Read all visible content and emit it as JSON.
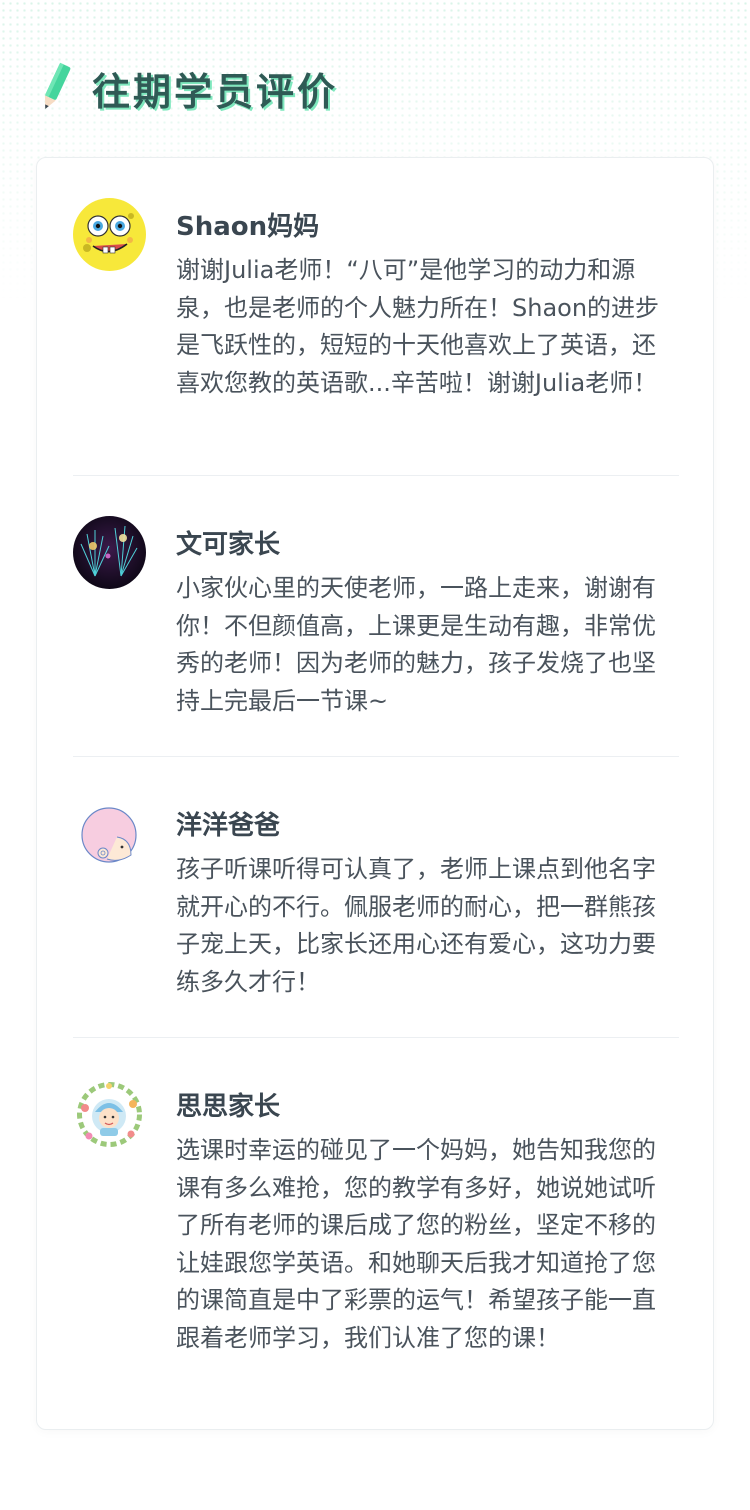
{
  "section": {
    "title": "往期学员评价"
  },
  "reviews": [
    {
      "name": "Shaon妈妈",
      "avatar": "spongebob-avatar",
      "comment": "谢谢Julia老师！“八可”是他学习的动力和源泉，也是老师的个人魅力所在！Shaon的进步是飞跃性的，短短的十天他喜欢上了英语，还喜欢您教的英语歌...辛苦啦！谢谢Julia老师！"
    },
    {
      "name": "文可家长",
      "avatar": "fireworks-avatar",
      "comment": "小家伙心里的天使老师，一路上走来，谢谢有你！不但颜值高，上课更是生动有趣，非常优秀的老师！因为老师的魅力，孩子发烧了也坚持上完最后一节课~"
    },
    {
      "name": "洋洋爸爸",
      "avatar": "cartoon-baby-avatar",
      "comment": "孩子听课听得可认真了，老师上课点到他名字就开心的不行。佩服老师的耐心，把一群熊孩子宠上天，比家长还用心还有爱心，这功力要练多久才行！"
    },
    {
      "name": "思思家长",
      "avatar": "flower-wreath-baby-avatar",
      "comment": "选课时幸运的碰见了一个妈妈，她告知我您的课有多么难抢，您的教学有多好，她说她试听了所有老师的课后成了您的粉丝，坚定不移的让娃跟您学英语。和她聊天后我才知道抢了您的课简直是中了彩票的运气！希望孩子能一直跟着老师学习，我们认准了您的课！"
    }
  ],
  "colors": {
    "title": "#2f5a55",
    "title_shadow": "#7ee7bd",
    "name": "#3a4650",
    "comment": "#4a535c",
    "pencil": "#45d59d"
  }
}
